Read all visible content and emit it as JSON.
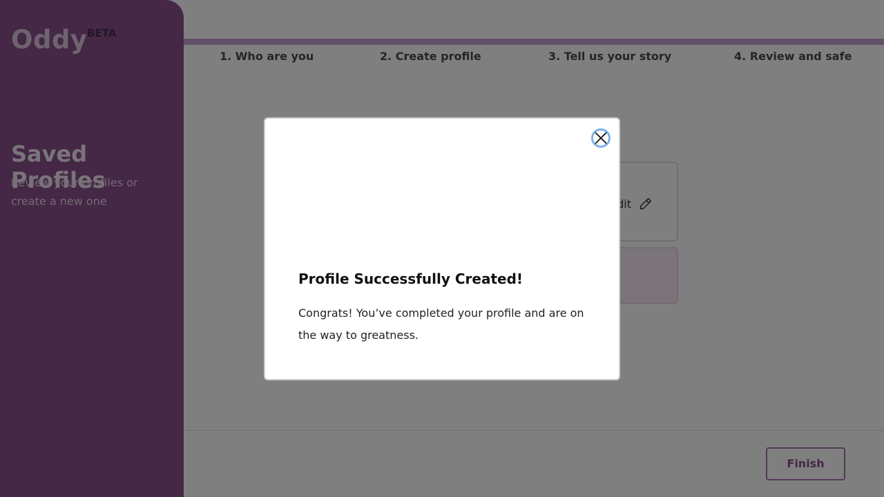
{
  "sidebar": {
    "logo": "Oddy",
    "badge": "BETA",
    "title": "Saved Profiles",
    "subtitle": "Review your profiles or create a new one"
  },
  "steps": [
    {
      "label": "1. Who are you"
    },
    {
      "label": "2. Create profile"
    },
    {
      "label": "3. Tell us your story"
    },
    {
      "label": "4. Review and safe"
    }
  ],
  "main": {
    "card_action_label": "dit"
  },
  "footer": {
    "finish_label": "Finish"
  },
  "modal": {
    "title": "Profile Successfully Created!",
    "body": "Congrats! You’ve completed your profile and are on the way to greatness.",
    "close_icon": "close-icon"
  },
  "colors": {
    "brand": "#8a4f8c",
    "accent_line": "#c6a3d0",
    "focus_ring": "#7fb0e8"
  }
}
